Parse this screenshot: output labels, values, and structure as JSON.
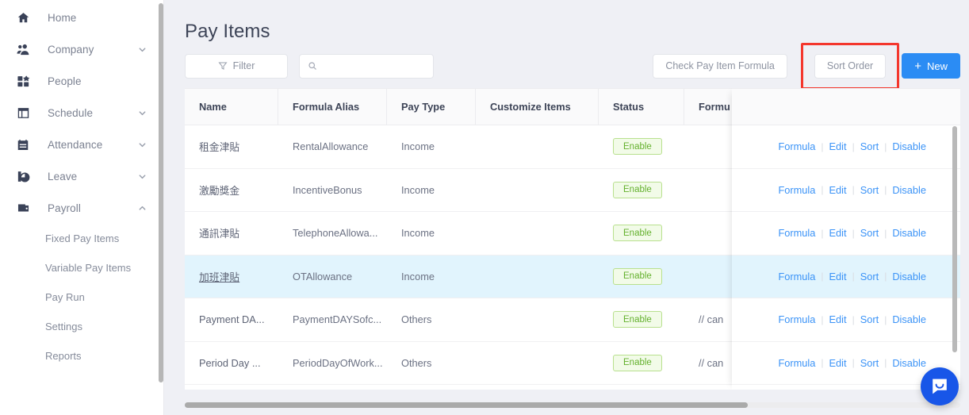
{
  "sidebar": {
    "items": [
      {
        "label": "Home",
        "icon": "home-icon",
        "caret": null
      },
      {
        "label": "Company",
        "icon": "users-icon",
        "caret": "down"
      },
      {
        "label": "People",
        "icon": "grid-icon",
        "caret": null
      },
      {
        "label": "Schedule",
        "icon": "window-icon",
        "caret": "down"
      },
      {
        "label": "Attendance",
        "icon": "clipboard-icon",
        "caret": "down"
      },
      {
        "label": "Leave",
        "icon": "clock-icon",
        "caret": "down"
      },
      {
        "label": "Payroll",
        "icon": "wallet-icon",
        "caret": "up"
      }
    ],
    "subitems": [
      {
        "label": "Fixed Pay Items"
      },
      {
        "label": "Variable Pay Items"
      },
      {
        "label": "Pay Run"
      },
      {
        "label": "Settings"
      },
      {
        "label": "Reports"
      }
    ]
  },
  "page": {
    "title": "Pay Items"
  },
  "toolbar": {
    "filter_label": "Filter",
    "search_value": "",
    "search_placeholder": "",
    "check_formula_label": "Check Pay Item Formula",
    "sort_order_label": "Sort Order",
    "new_label": "New",
    "new_plus": "+"
  },
  "highlight": {
    "color": "#f4372d",
    "target": "Sort Order"
  },
  "table": {
    "columns": [
      {
        "key": "name",
        "label": "Name"
      },
      {
        "key": "alias",
        "label": "Formula Alias"
      },
      {
        "key": "paytype",
        "label": "Pay Type"
      },
      {
        "key": "custom",
        "label": "Customize Items"
      },
      {
        "key": "status",
        "label": "Status"
      },
      {
        "key": "formula",
        "label": "Formu"
      }
    ],
    "rows": [
      {
        "name": "租金津貼",
        "alias": "RentalAllowance",
        "paytype": "Income",
        "custom": "",
        "status": "Enable",
        "formula": "",
        "active": false
      },
      {
        "name": "激勵獎金",
        "alias": "IncentiveBonus",
        "paytype": "Income",
        "custom": "",
        "status": "Enable",
        "formula": "",
        "active": false
      },
      {
        "name": "通訊津貼",
        "alias": "TelephoneAllowa...",
        "paytype": "Income",
        "custom": "",
        "status": "Enable",
        "formula": "",
        "active": false
      },
      {
        "name": "加班津貼",
        "alias": "OTAllowance",
        "paytype": "Income",
        "custom": "",
        "status": "Enable",
        "formula": "",
        "active": true
      },
      {
        "name": "Payment DA...",
        "alias": "PaymentDAYSofc...",
        "paytype": "Others",
        "custom": "",
        "status": "Enable",
        "formula": "// can",
        "active": false
      },
      {
        "name": "Period Day ...",
        "alias": "PeriodDayOfWork...",
        "paytype": "Others",
        "custom": "",
        "status": "Enable",
        "formula": "// can",
        "active": false
      }
    ],
    "actions": [
      "Formula",
      "Edit",
      "Sort",
      "Disable"
    ],
    "action_separator": "|"
  },
  "chat": {
    "icon": "chat-bubble-icon"
  }
}
